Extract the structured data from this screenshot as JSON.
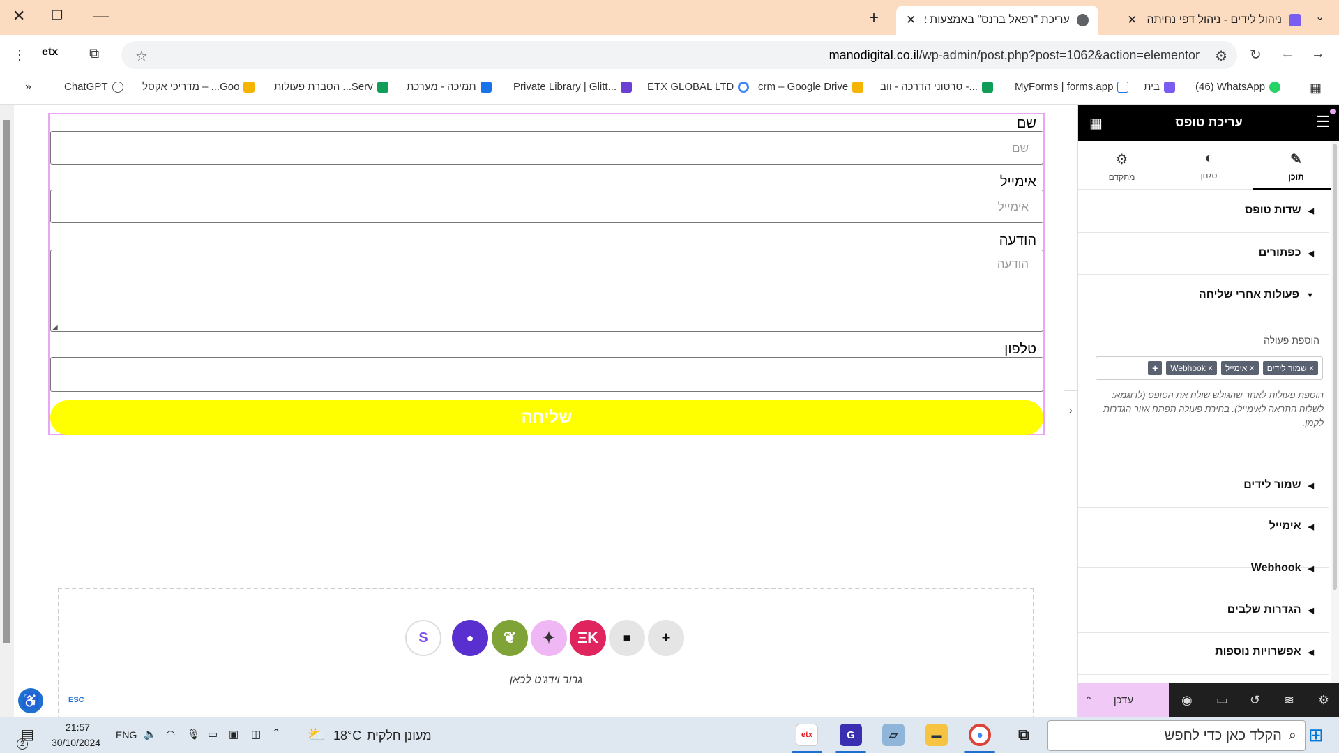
{
  "browser": {
    "tabs": [
      {
        "title": "ניהול לידים - ניהול דפי נחיתה",
        "active": false
      },
      {
        "title": "עריכת \"רפאל ברנס\" באמצעות א",
        "active": true
      }
    ],
    "url_host": "manodigital.co.il",
    "url_path": "/wp-admin/post.php?post=1062&action=elementor",
    "bookmarks": [
      "(46) WhatsApp",
      "בית",
      "MyForms | forms.app",
      "סרטוני הדרכה - ווב -...",
      "crm – Google Drive",
      "ETX GLOBAL LTD",
      "Private Library | Glitt...",
      "תמיכה - מערכת",
      "הסברת פעולות ...Serv",
      "מדריכי אקסל – ...Goo",
      "ChatGPT"
    ]
  },
  "form": {
    "name_label": "שם",
    "name_placeholder": "שם",
    "email_label": "אימייל",
    "email_placeholder": "אימייל",
    "message_label": "הודעה",
    "message_placeholder": "הודעה",
    "phone_label": "טלפון",
    "submit_label": "שליחה"
  },
  "dropzone": {
    "hint": "גרור וידג'ט לכאן"
  },
  "canvas": {
    "esc_label": "ESC"
  },
  "panel": {
    "title": "עריכת טופס",
    "tabs": [
      {
        "label": "תוכן",
        "icon": "pencil-icon",
        "active": true
      },
      {
        "label": "סגנון",
        "icon": "contrast-icon",
        "active": false
      },
      {
        "label": "מתקדם",
        "icon": "gear-icon",
        "active": false
      }
    ],
    "sections": {
      "form_fields": "שדות טופס",
      "buttons": "כפתורים",
      "actions_after_submit": "פעולות אחרי שליחה",
      "save_leads": "שמור לידים",
      "email": "אימייל",
      "webhook": "Webhook",
      "steps_settings": "הגדרות שלבים",
      "additional_options": "אפשרויות נוספות"
    },
    "add_action_label": "הוספת פעולה",
    "action_tags": [
      "שמור לידים",
      "אימייל",
      "Webhook"
    ],
    "help_text": "הוספת פעולות לאחר שהגולש שולח את הטופס (לדוגמא: לשלוח התראה לאימייל). בחירת פעולה תפתח אזור הגדרות לקמן.",
    "update_label": "עדכן"
  },
  "taskbar": {
    "search_placeholder": "הקלד כאן כדי לחפש",
    "weather_temp": "18°C",
    "weather_desc": "מעונן חלקית",
    "language": "ENG",
    "time": "21:57",
    "date": "30/10/2024",
    "notification_count": "2"
  },
  "colors": {
    "tab_strip": "#fbdcc0",
    "submit_button": "#ffff00",
    "form_outline": "#e9a7f3",
    "panel_header": "#000000",
    "update_button": "#f0c9f7"
  }
}
